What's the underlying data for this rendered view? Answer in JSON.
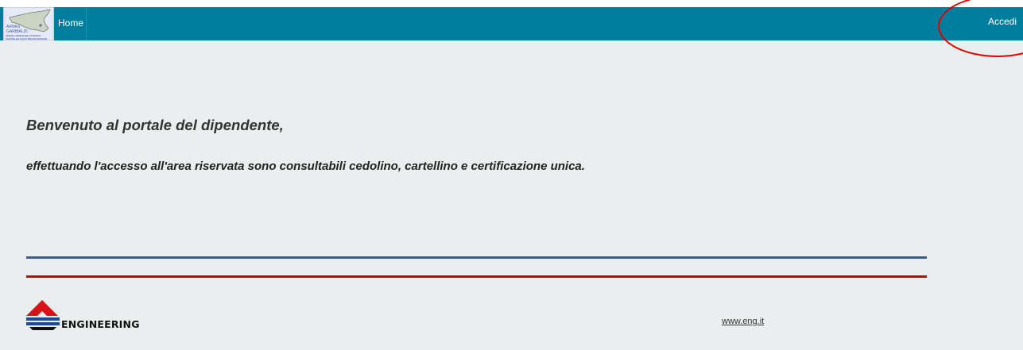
{
  "navbar": {
    "logo": {
      "line1": "ARNAS",
      "line2": "GARIBALDI",
      "tagline_1": "AZIENDA OSPEDALIERA DI RILIEVO",
      "tagline_2": "NAZIONALE E DI ALTA SPECIALIZZAZIONE"
    },
    "home_label": "Home",
    "login_label": "Accedi",
    "bg_color": "#007e9d"
  },
  "main": {
    "welcome": "Benvenuto al portale del dipendente,",
    "subtitle": "effettuando l'accesso all'area riservata sono consultabili cedolino, cartellino e certificazione unica."
  },
  "footer": {
    "brand": "ENGINEERING",
    "link": "www.eng.it",
    "rule_colors": [
      "#3d5a94",
      "#b10f14"
    ]
  },
  "icons": [
    "sicily-map-logo",
    "engineering-logo-mark"
  ],
  "annotation_color": "#e00000"
}
